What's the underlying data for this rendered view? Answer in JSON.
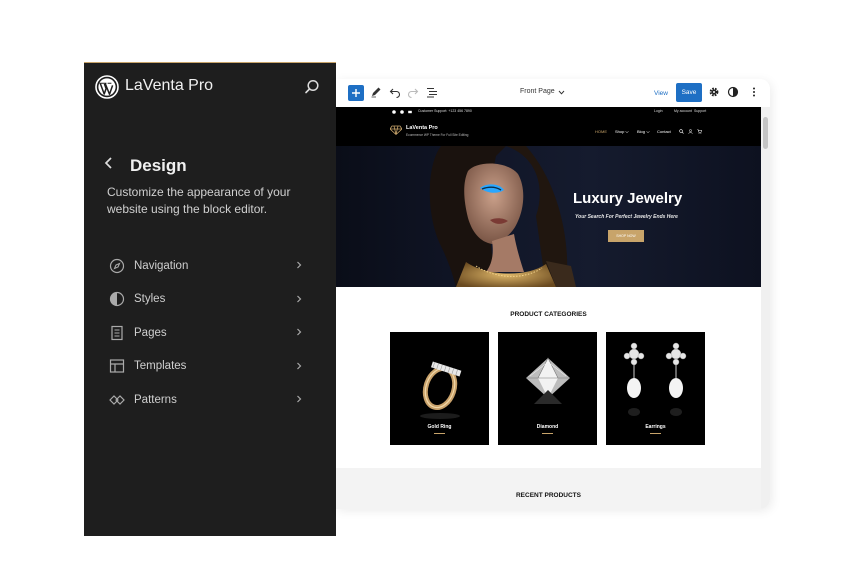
{
  "sidebar": {
    "site_title": "LaVenta Pro",
    "section_title": "Design",
    "description": "Customize the appearance of your website using the block editor.",
    "items": [
      {
        "label": "Navigation",
        "icon": "navigation-icon"
      },
      {
        "label": "Styles",
        "icon": "styles-icon"
      },
      {
        "label": "Pages",
        "icon": "pages-icon"
      },
      {
        "label": "Templates",
        "icon": "templates-icon"
      },
      {
        "label": "Patterns",
        "icon": "patterns-icon"
      }
    ]
  },
  "toolbar": {
    "page_selector": "Front Page",
    "view_label": "View",
    "save_label": "Save"
  },
  "site": {
    "topbar_contact": "Customer Support: +123 456 7890",
    "topbar_links": [
      "Login",
      "My account",
      "Support"
    ],
    "brand_name": "LaVenta Pro",
    "brand_tagline": "Ecommerce WP Theme For Full Site Editing",
    "nav": [
      "HOME",
      "Shop",
      "Blog",
      "Contact"
    ],
    "hero_title": "Luxury Jewelry",
    "hero_subtitle": "Your Search For Perfect Jewelry Ends Here",
    "hero_button": "SHOP NOW",
    "categories_title": "PRODUCT CATEGORIES",
    "categories": [
      {
        "label": "Gold Ring"
      },
      {
        "label": "Diamond"
      },
      {
        "label": "Earrings"
      }
    ],
    "recent_title": "RECENT PRODUCTS"
  },
  "colors": {
    "sidebar_bg": "#1e1e1e",
    "accent": "#1e6fc4",
    "gold": "#c8a46a"
  }
}
